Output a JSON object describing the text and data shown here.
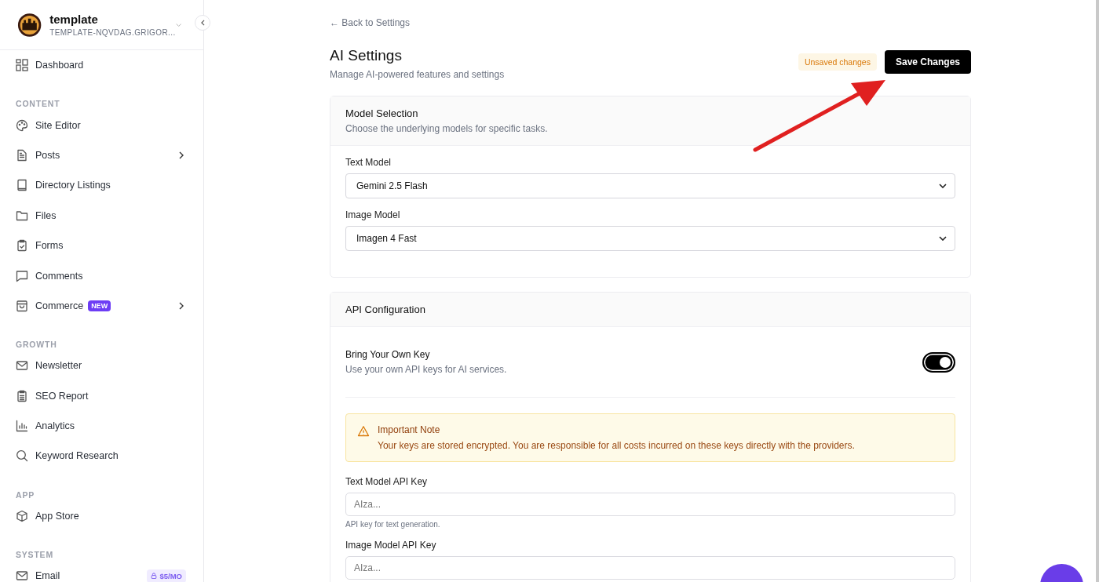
{
  "workspace": {
    "name": "template",
    "domain": "TEMPLATE-NQVDAG.GRIGOR..."
  },
  "sidebar": {
    "items_top": [
      {
        "label": "Dashboard"
      }
    ],
    "sections": [
      {
        "title": "CONTENT",
        "items": [
          {
            "label": "Site Editor",
            "has_submenu": false
          },
          {
            "label": "Posts",
            "has_submenu": true
          },
          {
            "label": "Directory Listings",
            "has_submenu": false
          },
          {
            "label": "Files",
            "has_submenu": false
          },
          {
            "label": "Forms",
            "has_submenu": false
          },
          {
            "label": "Comments",
            "has_submenu": false
          },
          {
            "label": "Commerce",
            "has_submenu": true,
            "badge": {
              "kind": "new",
              "text": "NEW"
            }
          }
        ]
      },
      {
        "title": "GROWTH",
        "items": [
          {
            "label": "Newsletter",
            "has_submenu": false
          },
          {
            "label": "SEO Report",
            "has_submenu": false
          },
          {
            "label": "Analytics",
            "has_submenu": false
          },
          {
            "label": "Keyword Research",
            "has_submenu": false
          }
        ]
      },
      {
        "title": "APP",
        "items": [
          {
            "label": "App Store",
            "has_submenu": false
          }
        ]
      },
      {
        "title": "SYSTEM",
        "items": [
          {
            "label": "Email",
            "has_submenu": false,
            "badge": {
              "kind": "price",
              "text": "$5/MO"
            }
          }
        ]
      }
    ]
  },
  "back_link": "← Back to Settings",
  "page": {
    "title": "AI Settings",
    "subtitle": "Manage AI-powered features and settings",
    "status": "Unsaved changes",
    "save_button": "Save Changes"
  },
  "model_selection": {
    "title": "Model Selection",
    "subtitle": "Choose the underlying models for specific tasks.",
    "fields": [
      {
        "label": "Text Model",
        "value": "Gemini 2.5 Flash"
      },
      {
        "label": "Image Model",
        "value": "Imagen 4 Fast"
      }
    ]
  },
  "api_configuration": {
    "title": "API Configuration",
    "byok": {
      "label": "Bring Your Own Key",
      "description": "Use your own API keys for AI services.",
      "on": true
    },
    "note": {
      "title": "Important Note",
      "text": "Your keys are stored encrypted. You are responsible for all costs incurred on these keys directly with the providers."
    },
    "keys": [
      {
        "label": "Text Model API Key",
        "placeholder": "AIza...",
        "help": "API key for text generation."
      },
      {
        "label": "Image Model API Key",
        "placeholder": "AIza..."
      }
    ]
  }
}
